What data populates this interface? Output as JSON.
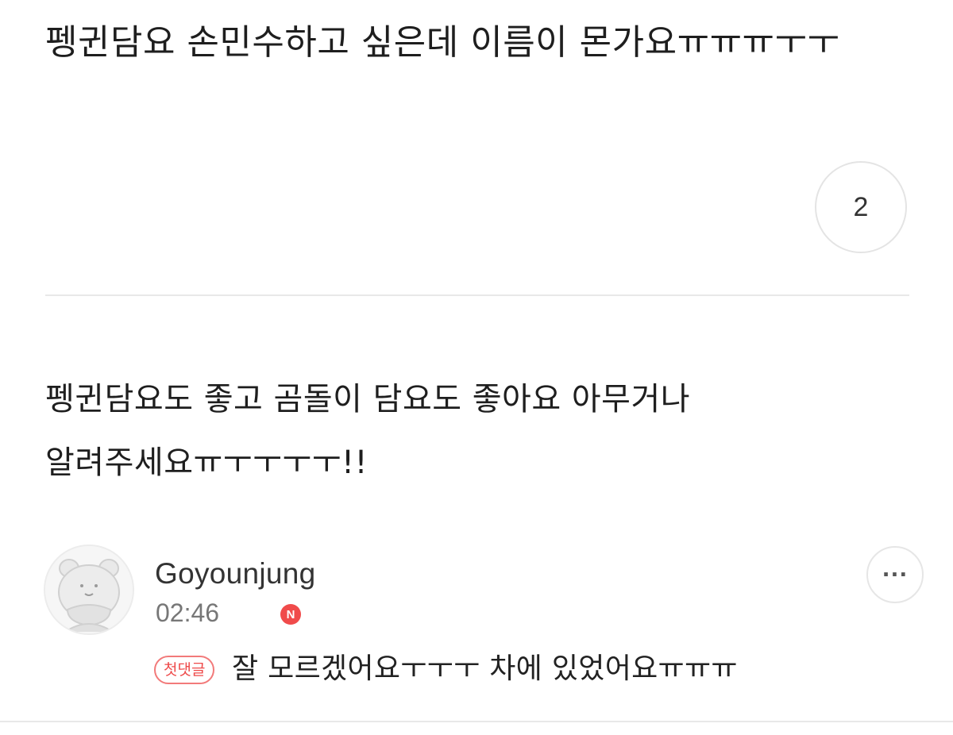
{
  "post": {
    "title": "펭귄담요 손민수하고 싶은데 이름이 몬가요ㅠㅠㅠㅜㅜ",
    "comment_count": "2",
    "body": "펭귄담요도 좋고 곰돌이 담요도 좋아요 아무거나 알려주세요ㅠㅜㅜㅜㅜ!!"
  },
  "comment": {
    "author": "Goyounjung",
    "time": "02:46",
    "new_badge": "N",
    "first_comment_badge": "첫댓글",
    "text": "잘 모르겠어요ㅜㅜㅜ 차에 있었어요ㅠㅠㅠ",
    "avatar_icon": "bear-avatar-icon",
    "more_icon": "more-options-icon"
  },
  "colors": {
    "accent_red": "#f04b4b",
    "divider": "#e8e8e8",
    "text": "#1e1e1e"
  }
}
